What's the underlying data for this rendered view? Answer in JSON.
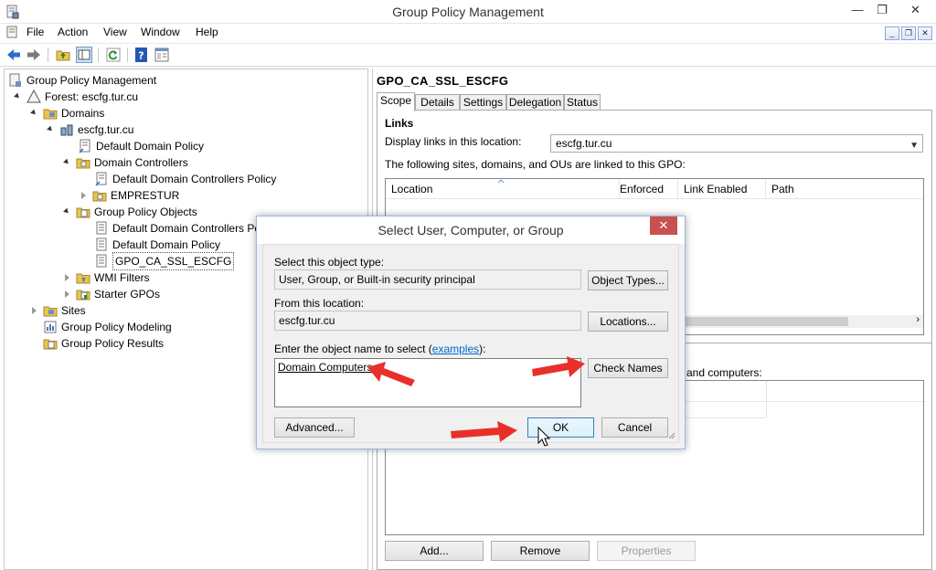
{
  "window": {
    "title": "Group Policy Management",
    "min_glyph": "—",
    "max_glyph": "❐",
    "close_glyph": "✕"
  },
  "menu": {
    "items": [
      "File",
      "Action",
      "View",
      "Window",
      "Help"
    ]
  },
  "tree": {
    "root": "Group Policy Management",
    "forest": "Forest: escfg.tur.cu",
    "domains": "Domains",
    "domain": "escfg.tur.cu",
    "default_domain_policy": "Default Domain Policy",
    "domain_controllers": "Domain Controllers",
    "default_dc_policy": "Default Domain Controllers Policy",
    "emprestur": "EMPRESTUR",
    "gpo_objects": "Group Policy Objects",
    "gpo_default_dc_policy": "Default Domain Controllers Pc",
    "gpo_default_domain_policy": "Default Domain Policy",
    "gpo_ssl": "GPO_CA_SSL_ESCFG",
    "wmi_filters": "WMI Filters",
    "starter_gpos": "Starter GPOs",
    "sites": "Sites",
    "modeling": "Group Policy Modeling",
    "results": "Group Policy Results"
  },
  "detail": {
    "title": "GPO_CA_SSL_ESCFG",
    "tabs": [
      "Scope",
      "Details",
      "Settings",
      "Delegation",
      "Status"
    ],
    "links_heading": "Links",
    "display_links_label": "Display links in this location:",
    "display_links_value": "escfg.tur.cu",
    "linked_text": "The following sites, domains, and OUs are linked to this GPO:",
    "columns": [
      "Location",
      "Enforced",
      "Link Enabled",
      "Path"
    ],
    "filter_text_partial": "and computers:",
    "add_label": "Add...",
    "remove_label": "Remove",
    "properties_label": "Properties"
  },
  "dialog": {
    "title": "Select User, Computer, or Group",
    "close_glyph": "✕",
    "object_type_label": "Select this object type:",
    "object_type_value": "User, Group, or Built-in security principal",
    "object_types_button": "Object Types...",
    "location_label": "From this location:",
    "location_value": "escfg.tur.cu",
    "locations_button": "Locations...",
    "enter_label_prefix": "Enter the object name to select (",
    "enter_label_link": "examples",
    "enter_label_suffix": "):",
    "object_name_value": "Domain Computers",
    "check_names_button": "Check Names",
    "advanced_button": "Advanced...",
    "ok_button": "OK",
    "cancel_button": "Cancel"
  },
  "colors": {
    "annotation_arrow": "#e8302a",
    "close_button": "#c75050",
    "link": "#0066cc"
  }
}
